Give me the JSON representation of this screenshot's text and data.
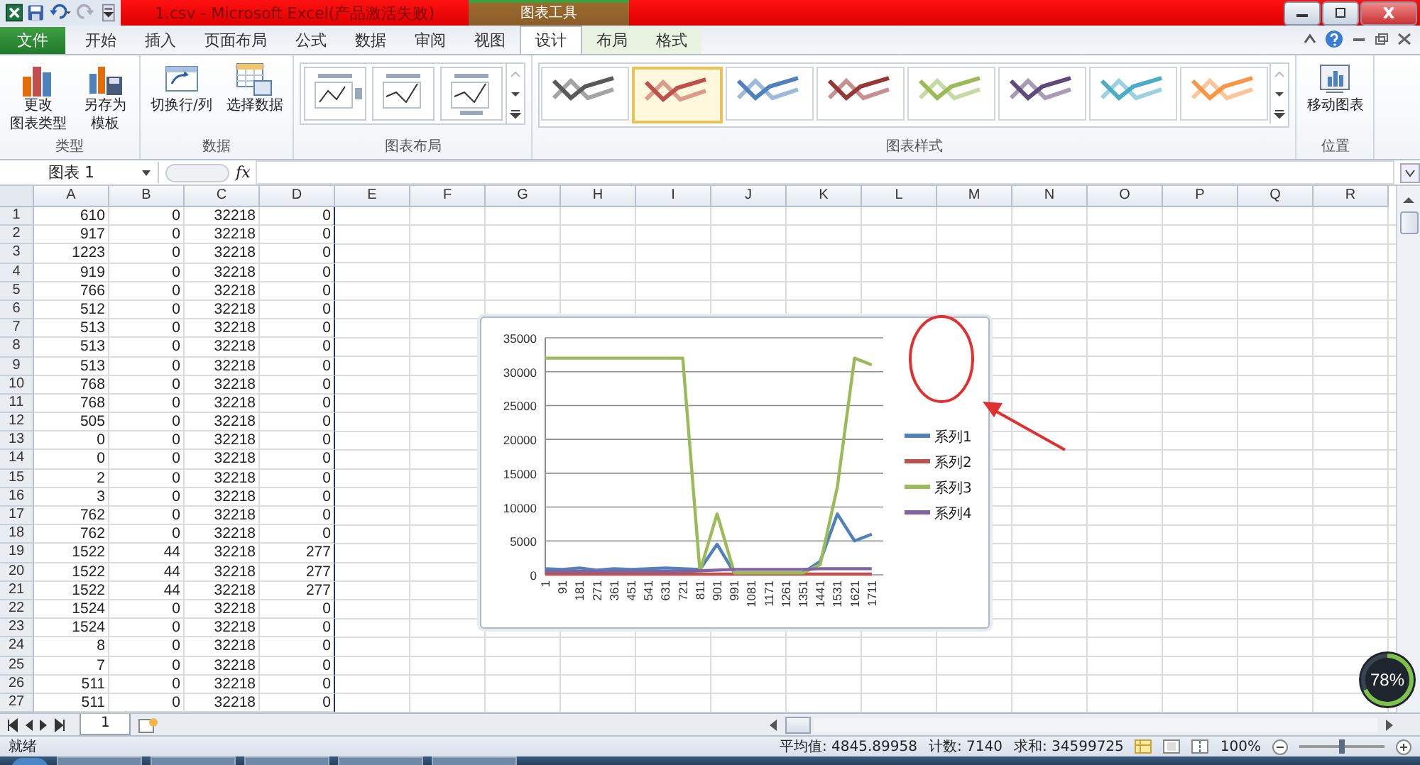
{
  "title_bar": {
    "title": "1.csv  -  Microsoft Excel(产品激活失败)",
    "context_label": "图表工具"
  },
  "tabs": [
    {
      "label": "文件",
      "kind": "file",
      "selected": false
    },
    {
      "label": "开始",
      "kind": "tab",
      "selected": false
    },
    {
      "label": "插入",
      "kind": "tab",
      "selected": false
    },
    {
      "label": "页面布局",
      "kind": "tab",
      "selected": false
    },
    {
      "label": "公式",
      "kind": "tab",
      "selected": false
    },
    {
      "label": "数据",
      "kind": "tab",
      "selected": false
    },
    {
      "label": "审阅",
      "kind": "tab",
      "selected": false
    },
    {
      "label": "视图",
      "kind": "tab",
      "selected": false
    },
    {
      "label": "设计",
      "kind": "context",
      "selected": true
    },
    {
      "label": "布局",
      "kind": "context",
      "selected": false
    },
    {
      "label": "格式",
      "kind": "context",
      "selected": false
    }
  ],
  "ribbon": {
    "groups": [
      {
        "kind": "buttons",
        "label": "类型",
        "buttons": [
          {
            "lines": [
              "更改",
              "图表类型"
            ]
          },
          {
            "lines": [
              "另存为",
              "模板"
            ]
          }
        ]
      },
      {
        "kind": "buttons",
        "label": "数据",
        "buttons": [
          {
            "lines": [
              "切换行/列"
            ]
          },
          {
            "lines": [
              "选择数据"
            ]
          }
        ]
      },
      {
        "kind": "layouts",
        "label": "图表布局",
        "items": [
          {
            "selected": false
          },
          {
            "selected": false
          },
          {
            "selected": false
          }
        ]
      },
      {
        "kind": "styles",
        "label": "图表样式",
        "items": [
          {
            "color": "#595959",
            "selected": false
          },
          {
            "color": "#c0504d",
            "selected": true
          },
          {
            "color": "#4f81bd",
            "selected": false
          },
          {
            "color": "#953735",
            "selected": false
          },
          {
            "color": "#9bbb59",
            "selected": false
          },
          {
            "color": "#5f497a",
            "selected": false
          },
          {
            "color": "#4bacc6",
            "selected": false
          },
          {
            "color": "#f79646",
            "selected": false
          }
        ]
      },
      {
        "kind": "buttons",
        "label": "位置",
        "buttons": [
          {
            "lines": [
              "移动图表"
            ]
          }
        ]
      }
    ]
  },
  "formula_bar": {
    "name_box": "图表 1",
    "fx_label": "fx"
  },
  "sheet": {
    "columns": [
      "A",
      "B",
      "C",
      "D",
      "E",
      "F",
      "G",
      "H",
      "I",
      "J",
      "K",
      "L",
      "M",
      "N",
      "O",
      "P",
      "Q",
      "R"
    ],
    "rows": [
      {
        "number": "1",
        "cells": [
          "610",
          "0",
          "32218",
          "0"
        ]
      },
      {
        "number": "2",
        "cells": [
          "917",
          "0",
          "32218",
          "0"
        ]
      },
      {
        "number": "3",
        "cells": [
          "1223",
          "0",
          "32218",
          "0"
        ]
      },
      {
        "number": "4",
        "cells": [
          "919",
          "0",
          "32218",
          "0"
        ]
      },
      {
        "number": "5",
        "cells": [
          "766",
          "0",
          "32218",
          "0"
        ]
      },
      {
        "number": "6",
        "cells": [
          "512",
          "0",
          "32218",
          "0"
        ]
      },
      {
        "number": "7",
        "cells": [
          "513",
          "0",
          "32218",
          "0"
        ]
      },
      {
        "number": "8",
        "cells": [
          "513",
          "0",
          "32218",
          "0"
        ]
      },
      {
        "number": "9",
        "cells": [
          "513",
          "0",
          "32218",
          "0"
        ]
      },
      {
        "number": "10",
        "cells": [
          "768",
          "0",
          "32218",
          "0"
        ]
      },
      {
        "number": "11",
        "cells": [
          "768",
          "0",
          "32218",
          "0"
        ]
      },
      {
        "number": "12",
        "cells": [
          "505",
          "0",
          "32218",
          "0"
        ]
      },
      {
        "number": "13",
        "cells": [
          "0",
          "0",
          "32218",
          "0"
        ]
      },
      {
        "number": "14",
        "cells": [
          "0",
          "0",
          "32218",
          "0"
        ]
      },
      {
        "number": "15",
        "cells": [
          "2",
          "0",
          "32218",
          "0"
        ]
      },
      {
        "number": "16",
        "cells": [
          "3",
          "0",
          "32218",
          "0"
        ]
      },
      {
        "number": "17",
        "cells": [
          "762",
          "0",
          "32218",
          "0"
        ]
      },
      {
        "number": "18",
        "cells": [
          "762",
          "0",
          "32218",
          "0"
        ]
      },
      {
        "number": "19",
        "cells": [
          "1522",
          "44",
          "32218",
          "277"
        ]
      },
      {
        "number": "20",
        "cells": [
          "1522",
          "44",
          "32218",
          "277"
        ]
      },
      {
        "number": "21",
        "cells": [
          "1522",
          "44",
          "32218",
          "277"
        ]
      },
      {
        "number": "22",
        "cells": [
          "1524",
          "0",
          "32218",
          "0"
        ]
      },
      {
        "number": "23",
        "cells": [
          "1524",
          "0",
          "32218",
          "0"
        ]
      },
      {
        "number": "24",
        "cells": [
          "8",
          "0",
          "32218",
          "0"
        ]
      },
      {
        "number": "25",
        "cells": [
          "7",
          "0",
          "32218",
          "0"
        ]
      },
      {
        "number": "26",
        "cells": [
          "511",
          "0",
          "32218",
          "0"
        ]
      },
      {
        "number": "27",
        "cells": [
          "511",
          "0",
          "32218",
          "0"
        ]
      }
    ]
  },
  "chart": {
    "chart_data": {
      "type": "line",
      "categories": [
        "1",
        "91",
        "181",
        "271",
        "361",
        "451",
        "541",
        "631",
        "721",
        "811",
        "901",
        "991",
        "1081",
        "1171",
        "1261",
        "1351",
        "1441",
        "1531",
        "1621",
        "1711"
      ],
      "ylim": [
        0,
        35000
      ],
      "grid": true,
      "legend": true,
      "yticks": [
        0,
        5000,
        10000,
        15000,
        20000,
        25000,
        30000,
        35000
      ],
      "series": [
        {
          "name": "系列1",
          "color": "#4f81bd",
          "values": [
            900,
            800,
            1000,
            700,
            900,
            800,
            900,
            1000,
            900,
            800,
            4500,
            300,
            200,
            200,
            200,
            300,
            2000,
            9000,
            5000,
            6000
          ]
        },
        {
          "name": "系列2",
          "color": "#c0504d",
          "values": [
            100,
            100,
            100,
            100,
            100,
            100,
            100,
            100,
            100,
            100,
            100,
            100,
            100,
            100,
            100,
            100,
            100,
            100,
            100,
            100
          ]
        },
        {
          "name": "系列3",
          "color": "#9bbb59",
          "values": [
            32000,
            32000,
            32000,
            32000,
            32000,
            32000,
            32000,
            32000,
            32000,
            500,
            9000,
            300,
            300,
            300,
            300,
            300,
            1500,
            13000,
            32000,
            31000
          ]
        },
        {
          "name": "系列4",
          "color": "#8064a2",
          "values": [
            500,
            500,
            500,
            500,
            500,
            500,
            500,
            500,
            500,
            600,
            700,
            800,
            800,
            800,
            800,
            800,
            900,
            900,
            900,
            900
          ]
        }
      ]
    }
  },
  "sheet_tabs": [
    {
      "label": "1",
      "selected": true
    }
  ],
  "status_bar": {
    "status": "就绪",
    "average": "平均值: 4845.89958",
    "count": "计数: 7140",
    "sum": "求和: 34599725",
    "zoom": "100%",
    "zoom_slider": {
      "level": 0.5
    }
  },
  "speed_badge": {
    "value": "78%"
  }
}
